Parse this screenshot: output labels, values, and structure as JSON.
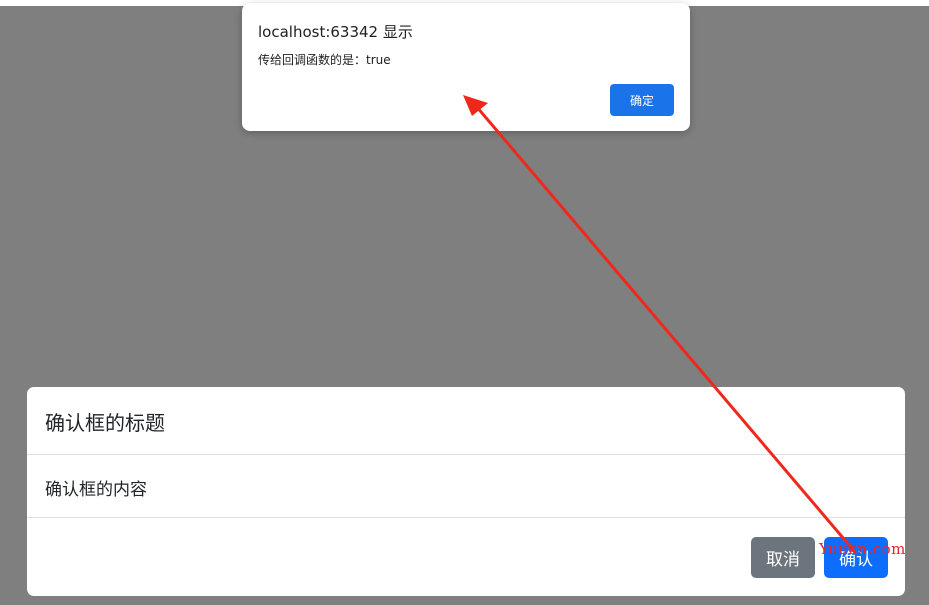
{
  "alert": {
    "title": "localhost:63342 显示",
    "message": "传给回调函数的是：true",
    "ok_label": "确定"
  },
  "modal": {
    "title": "确认框的标题",
    "content": "确认框的内容",
    "cancel_label": "取消",
    "confirm_label": "确认"
  },
  "annotation": {
    "arrow_color": "#f0281c"
  },
  "watermark": {
    "text": "Yuucn.com"
  },
  "colors": {
    "overlay": "#7f7f7f",
    "alert_button": "#1a73e8",
    "cancel_button": "#6c757d",
    "confirm_button": "#0d6efd"
  }
}
